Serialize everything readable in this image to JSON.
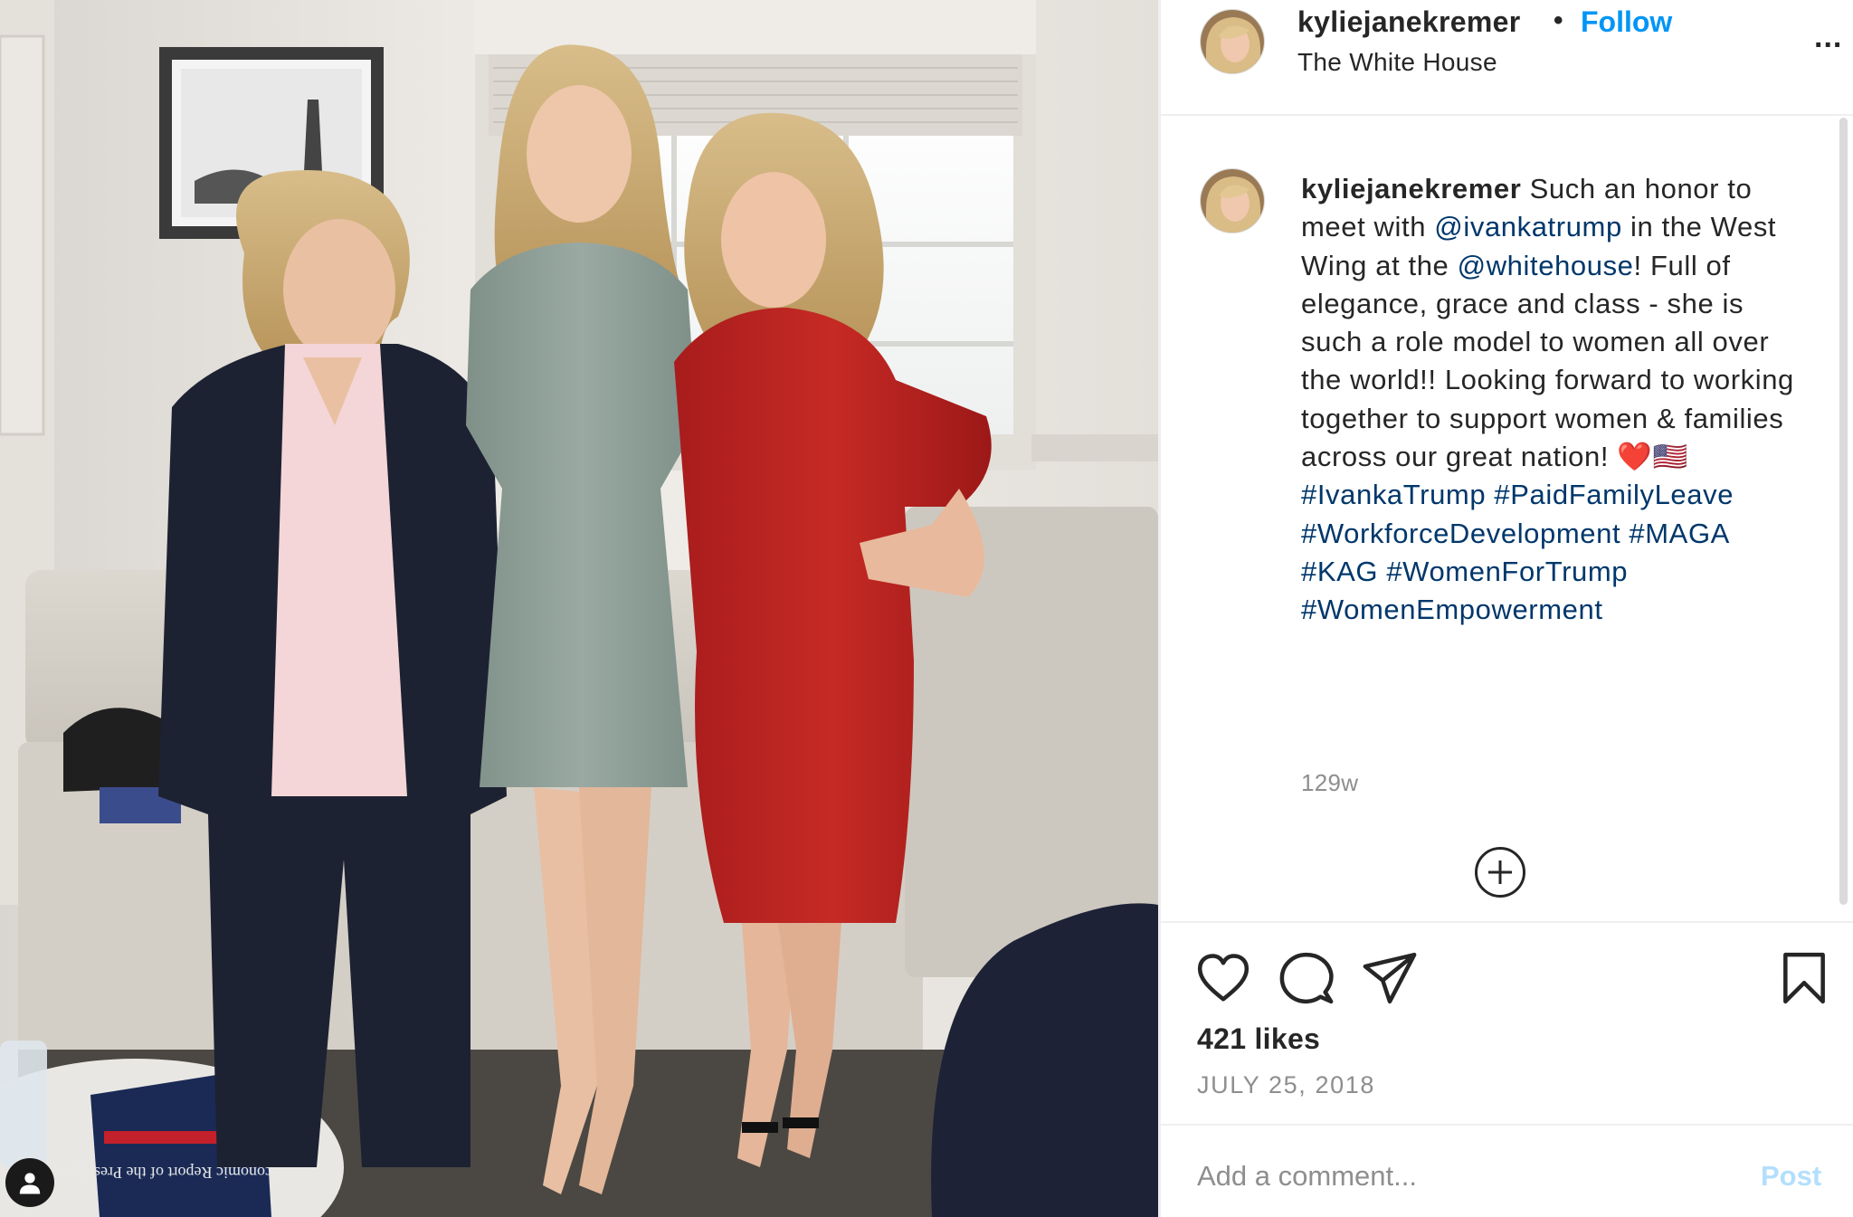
{
  "post": {
    "photo_alt": "Three women posing in a White House office",
    "book_text": "Economic Report of the President"
  },
  "header": {
    "username": "kyliejanekremer",
    "separator": "•",
    "follow_label": "Follow",
    "location": "The White House",
    "more_label": "..."
  },
  "caption": {
    "username": "kyliejanekremer",
    "text_1": " Such an honor to meet with ",
    "mention_1": "@ivankatrump",
    "text_2": " in the West Wing at the ",
    "mention_2": "@whitehouse",
    "text_3": "! Full of elegance, grace and class - she is such a role model to women all over the world!! Looking forward to working together to support women & families across our great nation! ",
    "emoji": "❤️🇺🇸",
    "hashtags": [
      "#IvankaTrump",
      "#PaidFamilyLeave",
      "#WorkforceDevelopment",
      "#MAGA",
      "#KAG",
      "#WomenForTrump",
      "#WomenEmpowerment"
    ],
    "time_ago": "129w"
  },
  "actions": {
    "icons": [
      "heart-icon",
      "comment-icon",
      "share-icon",
      "bookmark-icon"
    ],
    "likes": "421 likes",
    "date": "JULY 25, 2018"
  },
  "comment": {
    "placeholder": "Add a comment...",
    "post_label": "Post"
  },
  "colors": {
    "link": "#00376b",
    "follow": "#0095f6",
    "muted": "#8e8e8e",
    "post_disabled": "#b2dffc",
    "heart_emoji": "#e0245e"
  }
}
